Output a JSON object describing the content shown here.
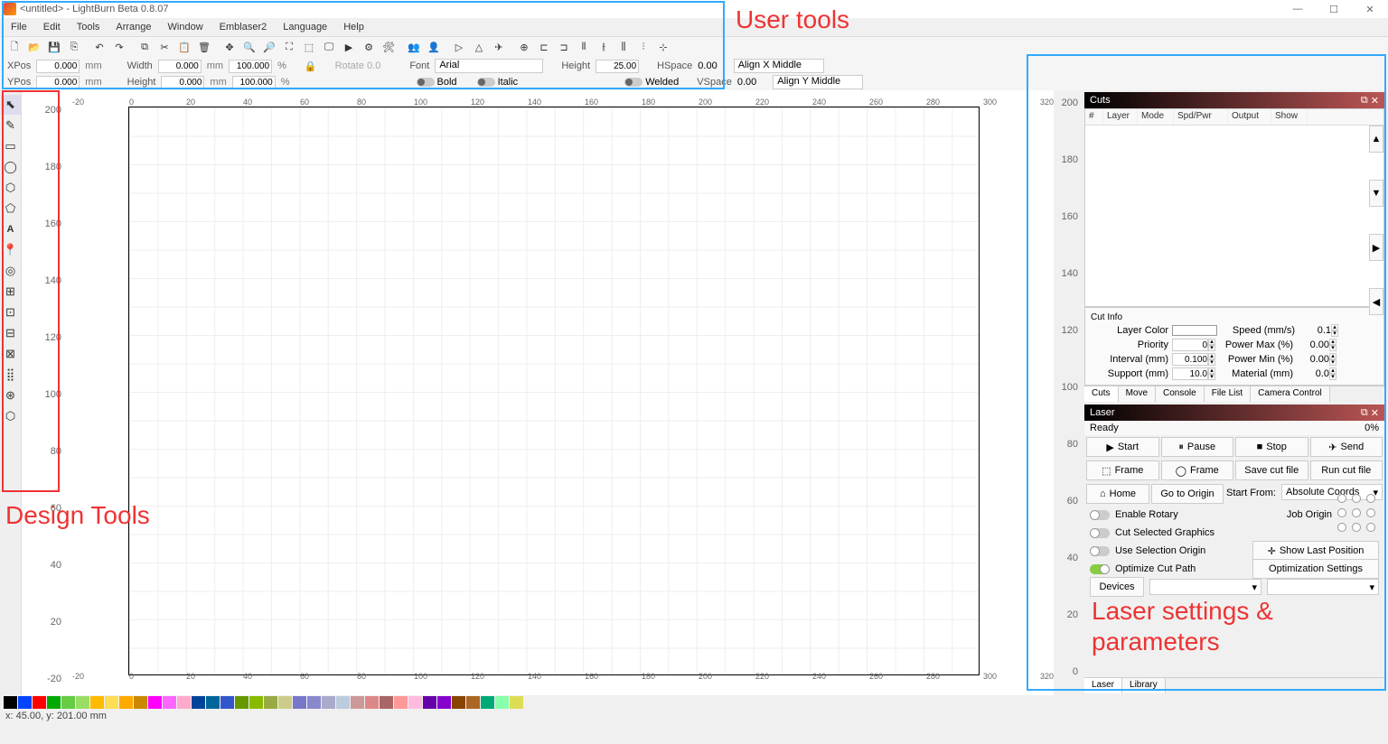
{
  "title": "<untitled> - LightBurn Beta 0.8.07",
  "menu": [
    "File",
    "Edit",
    "Tools",
    "Arrange",
    "Window",
    "Emblaser2",
    "Language",
    "Help"
  ],
  "prop1": {
    "xpos": "XPos",
    "xval": "0.000",
    "xunit": "mm",
    "widthL": "Width",
    "wval": "0.000",
    "wunit": "mm",
    "wpct": "100.000",
    "pctunit": "%",
    "rotate": "Rotate 0.0",
    "fontL": "Font",
    "font": "Arial",
    "heightL": "Height",
    "height": "25.00",
    "hspaceL": "HSpace",
    "hspace": "0.00",
    "alignx": "Align X Middle"
  },
  "prop2": {
    "ypos": "YPos",
    "yval": "0.000",
    "yunit": "mm",
    "heightL": "Height",
    "hval": "0.000",
    "hunit": "mm",
    "hpct": "100.000",
    "pctunit": "%",
    "bold": "Bold",
    "italic": "Italic",
    "welded": "Welded",
    "vspaceL": "VSpace",
    "vspace": "0.00",
    "aligny": "Align Y Middle"
  },
  "ruler_x": [
    "-20",
    "0",
    "20",
    "40",
    "60",
    "80",
    "100",
    "120",
    "140",
    "160",
    "180",
    "200",
    "220",
    "240",
    "260",
    "280",
    "300",
    "320"
  ],
  "ruler_y": [
    "200",
    "180",
    "160",
    "140",
    "120",
    "100",
    "80",
    "60",
    "40",
    "20",
    "-20"
  ],
  "ruler_y_right": [
    "200",
    "180",
    "160",
    "140",
    "120",
    "100",
    "80",
    "60",
    "40",
    "20",
    "0"
  ],
  "cuts": {
    "title": "Cuts",
    "cols": [
      "#",
      "Layer",
      "Mode",
      "Spd/Pwr",
      "Output",
      "Show"
    ],
    "cutinfoTitle": "Cut Info",
    "layerColor": "Layer Color",
    "speed": "Speed (mm/s)",
    "speedv": "0.1",
    "priority": "Priority",
    "priorityv": "0",
    "pmax": "Power Max (%)",
    "pmaxv": "0.00",
    "interval": "Interval (mm)",
    "intervalv": "0.100",
    "pmin": "Power Min (%)",
    "pminv": "0.00",
    "support": "Support (mm)",
    "supportv": "10.0",
    "material": "Material (mm)",
    "materialv": "0.0",
    "tabs": [
      "Cuts",
      "Move",
      "Console",
      "File List",
      "Camera Control"
    ]
  },
  "laser": {
    "title": "Laser",
    "ready": "Ready",
    "pct": "0%",
    "start": "Start",
    "pause": "Pause",
    "stop": "Stop",
    "send": "Send",
    "frame": "Frame",
    "frame2": "Frame",
    "savecut": "Save cut file",
    "runcut": "Run cut file",
    "home": "Home",
    "goOrigin": "Go to Origin",
    "startFrom": "Start From:",
    "startFromV": "Absolute Coords",
    "enableRotary": "Enable Rotary",
    "jobOrigin": "Job Origin",
    "cutSel": "Cut Selected Graphics",
    "useSel": "Use Selection Origin",
    "showLast": "Show Last Position",
    "optimize": "Optimize Cut Path",
    "optSettings": "Optimization Settings",
    "devices": "Devices",
    "tabs": [
      "Laser",
      "Library"
    ]
  },
  "colors": [
    "#000",
    "#04f",
    "#f00",
    "#0a0",
    "#6c4",
    "#9d6",
    "#fb0",
    "#fd5",
    "#fa0",
    "#c80",
    "#f0f",
    "#f6f",
    "#fac",
    "#049",
    "#069",
    "#35c",
    "#690",
    "#8b0",
    "#9a4",
    "#cc8",
    "#77c",
    "#88c",
    "#aac",
    "#bcd",
    "#c99",
    "#d88",
    "#a66",
    "#f99",
    "#fbd",
    "#60a",
    "#80c",
    "#840",
    "#a62",
    "#0a7",
    "#8fa",
    "#dd5"
  ],
  "status": "x: 45.00, y: 201.00 mm",
  "annot": {
    "user": "User tools",
    "design": "Design Tools",
    "laser": "Laser settings & parameters"
  }
}
